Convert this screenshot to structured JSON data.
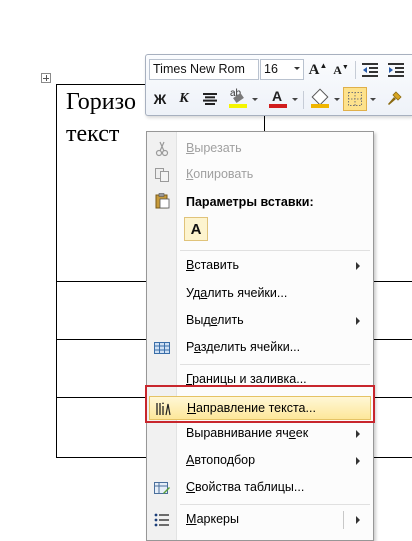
{
  "document": {
    "cell_text_line1": "Горизо",
    "cell_text_line2": "текст"
  },
  "mini_toolbar": {
    "font_name": "Times New Rom",
    "font_size": "16",
    "bold_label": "Ж",
    "italic_label": "К",
    "font_color_label": "А",
    "highlight_label": "ab",
    "colors": {
      "highlight": "#f5f500",
      "font_color": "#d11d1d",
      "shading": "#f0b500"
    }
  },
  "context_menu": {
    "items": [
      {
        "id": "cut",
        "prefix": "",
        "accel": "В",
        "suffix": "ырезать",
        "disabled": true,
        "icon": "scissors-icon"
      },
      {
        "id": "copy",
        "prefix": "",
        "accel": "К",
        "suffix": "опировать",
        "disabled": true,
        "icon": "copy-icon"
      },
      {
        "id": "insert",
        "prefix": "",
        "accel": "В",
        "suffix": "ставить",
        "submenu": true
      },
      {
        "id": "delete-cells",
        "prefix": "Уд",
        "accel": "а",
        "suffix": "лить ячейки...",
        "submenu": false
      },
      {
        "id": "select",
        "prefix": "Выд",
        "accel": "е",
        "suffix": "лить",
        "submenu": true
      },
      {
        "id": "split-cells",
        "prefix": "Р",
        "accel": "а",
        "suffix": "зделить ячейки...",
        "icon": "split-cells-icon"
      },
      {
        "id": "borders",
        "prefix": "",
        "accel": "Г",
        "suffix": "раницы и заливка..."
      },
      {
        "id": "text-direction",
        "prefix": "",
        "accel": "Н",
        "suffix": "аправление текста...",
        "icon": "text-direction-icon",
        "highlighted": true
      },
      {
        "id": "cell-alignment",
        "prefix": "Выравнивание яч",
        "accel": "е",
        "suffix": "ек",
        "submenu": true
      },
      {
        "id": "autofit",
        "prefix": "",
        "accel": "А",
        "suffix": "втоподбор",
        "submenu": true
      },
      {
        "id": "table-properties",
        "prefix": "",
        "accel": "С",
        "suffix": "войства таблицы...",
        "icon": "table-properties-icon"
      },
      {
        "id": "bullets",
        "prefix": "",
        "accel": "М",
        "suffix": "аркеры",
        "icon": "bullets-icon",
        "submenu": true,
        "split": true
      }
    ],
    "paste_heading": "Параметры вставки:",
    "paste_option_label": "A"
  }
}
